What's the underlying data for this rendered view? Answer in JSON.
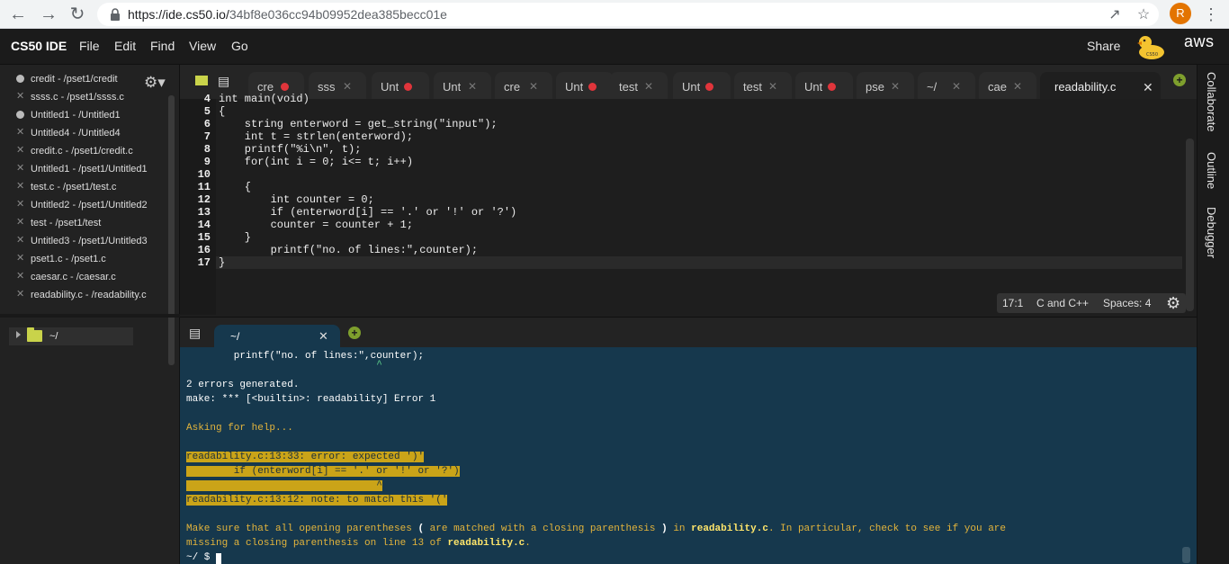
{
  "browser": {
    "url_host": "https://ide.cs50.io/",
    "url_path": "34bf8e036cc94b09952dea385becc01e",
    "avatar_letter": "R",
    "back_icon": "arrow-left-icon",
    "forward_icon": "arrow-right-icon",
    "reload_icon": "reload-icon"
  },
  "menubar": {
    "brand": "CS50 IDE",
    "items": [
      "File",
      "Edit",
      "Find",
      "View",
      "Go"
    ],
    "share": "Share",
    "aws": "aws"
  },
  "open_files": [
    {
      "label": "credit - /pset1/credit",
      "mark": "dot"
    },
    {
      "label": "ssss.c - /pset1/ssss.c",
      "mark": "x"
    },
    {
      "label": "Untitled1 - /Untitled1",
      "mark": "dot"
    },
    {
      "label": "Untitled4 - /Untitled4",
      "mark": "x"
    },
    {
      "label": "credit.c - /pset1/credit.c",
      "mark": "x"
    },
    {
      "label": "Untitled1 - /pset1/Untitled1",
      "mark": "x"
    },
    {
      "label": "test.c - /pset1/test.c",
      "mark": "x"
    },
    {
      "label": "Untitled2 - /pset1/Untitled2",
      "mark": "x"
    },
    {
      "label": "test - /pset1/test",
      "mark": "x"
    },
    {
      "label": "Untitled3 - /pset1/Untitled3",
      "mark": "x"
    },
    {
      "label": "pset1.c - /pset1.c",
      "mark": "x"
    },
    {
      "label": "caesar.c - /caesar.c",
      "mark": "x"
    },
    {
      "label": "readability.c - /readability.c",
      "mark": "x"
    }
  ],
  "file_tree": {
    "root": "~/"
  },
  "tabs": [
    {
      "label": "cre",
      "state": "dot"
    },
    {
      "label": "sss",
      "state": "x"
    },
    {
      "label": "Unt",
      "state": "dot"
    },
    {
      "label": "Unt",
      "state": "x"
    },
    {
      "label": "cre",
      "state": "x"
    },
    {
      "label": "Unt",
      "state": "dot"
    },
    {
      "label": "test",
      "state": "x"
    },
    {
      "label": "Unt",
      "state": "dot"
    },
    {
      "label": "test",
      "state": "x"
    },
    {
      "label": "Unt",
      "state": "dot"
    },
    {
      "label": "pse",
      "state": "x"
    },
    {
      "label": "~/",
      "state": "x"
    },
    {
      "label": "cae",
      "state": "x"
    },
    {
      "label": "readability.c",
      "state": "active"
    }
  ],
  "editor": {
    "lines": [
      {
        "n": "4",
        "text": "int main(void)"
      },
      {
        "n": "5",
        "text": "{"
      },
      {
        "n": "6",
        "text": "    string enterword = get_string(\"input\");"
      },
      {
        "n": "7",
        "text": "    int t = strlen(enterword);"
      },
      {
        "n": "8",
        "text": "    printf(\"%i\\n\", t);"
      },
      {
        "n": "9",
        "text": "    for(int i = 0; i<= t; i++)"
      },
      {
        "n": "10",
        "text": ""
      },
      {
        "n": "11",
        "text": "    {"
      },
      {
        "n": "12",
        "text": "        int counter = 0;"
      },
      {
        "n": "13",
        "text": "        if (enterword[i] == '.' or '!' or '?')"
      },
      {
        "n": "14",
        "text": "        counter = counter + 1;"
      },
      {
        "n": "15",
        "text": "    }"
      },
      {
        "n": "16",
        "text": "        printf(\"no. of lines:\",counter);"
      },
      {
        "n": "17",
        "text": "}"
      }
    ],
    "status": {
      "position": "17:1",
      "language": "C and C++",
      "spaces": "Spaces: 4"
    }
  },
  "terminal": {
    "tab_label": "~/",
    "lines": [
      {
        "text": "        printf(\"no. of lines:\",counter);",
        "style": "white"
      },
      {
        "text": "                                ^",
        "style": "caret"
      },
      {
        "text": "2 errors generated.",
        "style": "white"
      },
      {
        "text": "make: *** [<builtin>: readability] Error 1",
        "style": "white"
      },
      {
        "text": "",
        "style": "white"
      },
      {
        "text": "Asking for help...",
        "style": "yellow"
      },
      {
        "text": "",
        "style": "white"
      },
      {
        "text": "readability.c:13:33: error: expected ')'",
        "style": "hl"
      },
      {
        "text": "        if (enterword[i] == '.' or '!' or '?')",
        "style": "hl"
      },
      {
        "text": "                                ^",
        "style": "hl"
      },
      {
        "text": "readability.c:13:12: note: to match this '('",
        "style": "hl"
      },
      {
        "text": "",
        "style": "white"
      }
    ],
    "help1_a": "Make sure that all opening parentheses ",
    "help1_b": "(",
    "help1_c": " are matched with a closing parenthesis ",
    "help1_d": ")",
    "help1_e": " in ",
    "help1_f": "readability.c",
    "help1_g": ". In particular, check to see if you are",
    "help2_a": "missing a closing parenthesis on line 13 of ",
    "help2_b": "readability.c",
    "help2_c": ".",
    "prompt": "~/ $"
  },
  "right_panel": [
    "Collaborate",
    "Outline",
    "Debugger"
  ]
}
